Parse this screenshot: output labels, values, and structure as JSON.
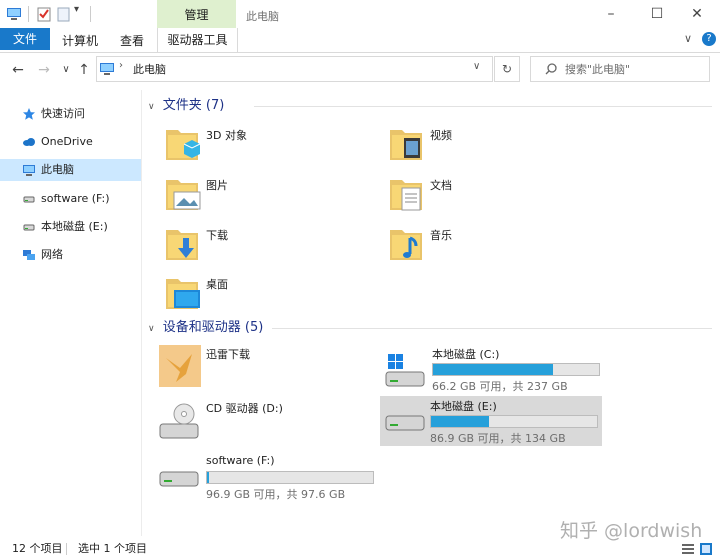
{
  "window": {
    "title": "此电脑",
    "context_tab": "管理",
    "minimize": "–",
    "maximize": "☐",
    "close": "✕"
  },
  "ribbon": {
    "file": "文件",
    "computer": "计算机",
    "view": "查看",
    "drive_tools": "驱动器工具",
    "collapse": "∨",
    "help": "?"
  },
  "address": {
    "back": "←",
    "forward": "→",
    "recent": "∨",
    "up": "↑",
    "path": "此电脑",
    "dropdown": "∨",
    "refresh": "↻",
    "search_placeholder": "搜索\"此电脑\""
  },
  "nav": {
    "items": [
      {
        "label": "快速访问",
        "icon": "star-icon"
      },
      {
        "label": "OneDrive",
        "icon": "cloud-icon"
      },
      {
        "label": "此电脑",
        "icon": "computer-icon"
      },
      {
        "label": "software (F:)",
        "icon": "drive-icon"
      },
      {
        "label": "本地磁盘 (E:)",
        "icon": "drive-icon"
      },
      {
        "label": "网络",
        "icon": "network-icon"
      }
    ]
  },
  "folders": {
    "header": "文件夹 (7)",
    "items": [
      {
        "label": "3D 对象",
        "icon": "3d-objects-folder-icon"
      },
      {
        "label": "视频",
        "icon": "videos-folder-icon"
      },
      {
        "label": "图片",
        "icon": "pictures-folder-icon"
      },
      {
        "label": "文档",
        "icon": "documents-folder-icon"
      },
      {
        "label": "下载",
        "icon": "downloads-folder-icon"
      },
      {
        "label": "音乐",
        "icon": "music-folder-icon"
      },
      {
        "label": "桌面",
        "icon": "desktop-folder-icon"
      }
    ]
  },
  "devices": {
    "header": "设备和驱动器 (5)",
    "items": [
      {
        "label": "迅雷下载",
        "icon": "xunlei-icon"
      },
      {
        "label": "本地磁盘 (C:)",
        "sub": "66.2 GB 可用，共 237 GB",
        "used_fraction": 0.72,
        "icon": "windows-drive-icon"
      },
      {
        "label": "CD 驱动器 (D:)",
        "icon": "cd-drive-icon"
      },
      {
        "label": "本地磁盘 (E:)",
        "sub": "86.9 GB 可用，共 134 GB",
        "used_fraction": 0.35,
        "icon": "drive-icon"
      },
      {
        "label": "software (F:)",
        "sub": "96.9 GB 可用，共 97.6 GB",
        "used_fraction": 0.01,
        "icon": "drive-icon"
      }
    ]
  },
  "status": {
    "count": "12 个项目",
    "selection": "选中 1 个项目"
  },
  "watermark": "知乎 @lordwish",
  "colors": {
    "accent": "#1979ca",
    "drive_fill": "#26a0da",
    "selection": "#cce8ff",
    "manage_tab": "#dff0cf"
  }
}
